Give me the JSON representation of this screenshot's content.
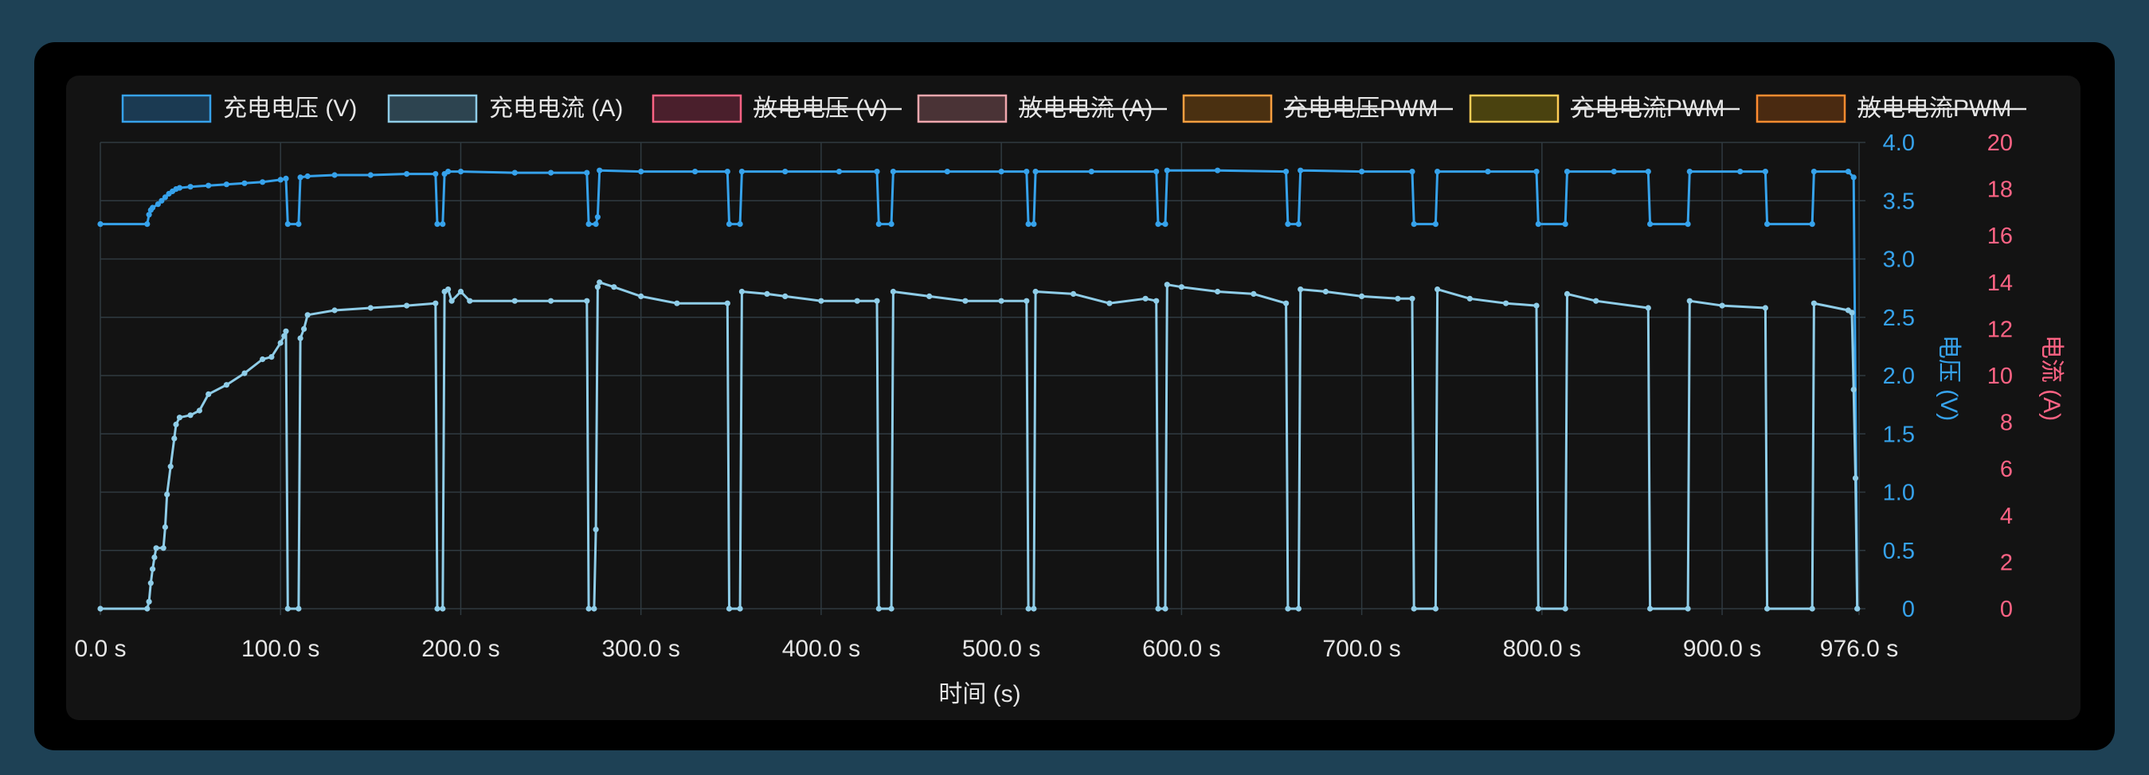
{
  "chart_data": {
    "type": "line",
    "title": "",
    "xlabel": "时间 (s)",
    "ylabel_left": "电压 (V)",
    "ylabel_right": "电流 (A)",
    "xlim": [
      0,
      976
    ],
    "ylim_left": [
      0,
      4
    ],
    "ylim_right": [
      0,
      20
    ],
    "x_ticks": [
      "0.0 s",
      "100.0 s",
      "200.0 s",
      "300.0 s",
      "400.0 s",
      "500.0 s",
      "600.0 s",
      "700.0 s",
      "800.0 s",
      "900.0 s",
      "976.0 s"
    ],
    "y_ticks_left": [
      "0",
      "0.5",
      "1.0",
      "1.5",
      "2.0",
      "2.5",
      "3.0",
      "3.5",
      "4.0"
    ],
    "y_ticks_right": [
      "0",
      "2",
      "4",
      "6",
      "8",
      "10",
      "12",
      "14",
      "16",
      "18",
      "20"
    ],
    "grid": true,
    "legend_position": "top",
    "legend": [
      {
        "label": "充电电压 (V)",
        "visible": true,
        "fill": "#1b3a52",
        "stroke": "#36a2eb"
      },
      {
        "label": "充电电流 (A)",
        "visible": true,
        "fill": "#2d4450",
        "stroke": "#8fcde8"
      },
      {
        "label": "放电电压 (V)",
        "visible": false,
        "fill": "#4a1f2c",
        "stroke": "#ff6384"
      },
      {
        "label": "放电电流 (A)",
        "visible": false,
        "fill": "#4a3336",
        "stroke": "#f2a7ae"
      },
      {
        "label": "充电电压PWM",
        "visible": false,
        "fill": "#4a3011",
        "stroke": "#ff9f40"
      },
      {
        "label": "充电电流PWM",
        "visible": false,
        "fill": "#4a420f",
        "stroke": "#ffcd56"
      },
      {
        "label": "放电电流PWM",
        "visible": false,
        "fill": "#4a2a11",
        "stroke": "#ff8c30"
      }
    ],
    "series": [
      {
        "name": "充电电压 (V)",
        "axis": "left",
        "color": "#36a2eb",
        "points": [
          [
            0,
            3.3
          ],
          [
            26,
            3.3
          ],
          [
            27,
            3.38
          ],
          [
            28,
            3.42
          ],
          [
            29,
            3.44
          ],
          [
            32,
            3.47
          ],
          [
            34,
            3.5
          ],
          [
            36,
            3.53
          ],
          [
            38,
            3.56
          ],
          [
            40,
            3.58
          ],
          [
            42,
            3.6
          ],
          [
            44,
            3.61
          ],
          [
            50,
            3.62
          ],
          [
            60,
            3.63
          ],
          [
            70,
            3.64
          ],
          [
            80,
            3.65
          ],
          [
            90,
            3.66
          ],
          [
            100,
            3.68
          ],
          [
            103,
            3.69
          ],
          [
            104,
            3.3
          ],
          [
            110,
            3.3
          ],
          [
            111,
            3.7
          ],
          [
            115,
            3.71
          ],
          [
            130,
            3.72
          ],
          [
            150,
            3.72
          ],
          [
            170,
            3.73
          ],
          [
            186,
            3.73
          ],
          [
            187,
            3.3
          ],
          [
            190,
            3.3
          ],
          [
            191,
            3.73
          ],
          [
            193,
            3.75
          ],
          [
            200,
            3.75
          ],
          [
            230,
            3.74
          ],
          [
            250,
            3.74
          ],
          [
            270,
            3.74
          ],
          [
            271,
            3.3
          ],
          [
            275,
            3.3
          ],
          [
            276,
            3.36
          ],
          [
            277,
            3.76
          ],
          [
            300,
            3.75
          ],
          [
            330,
            3.75
          ],
          [
            348,
            3.75
          ],
          [
            349,
            3.3
          ],
          [
            355,
            3.3
          ],
          [
            356,
            3.75
          ],
          [
            380,
            3.75
          ],
          [
            410,
            3.75
          ],
          [
            431,
            3.75
          ],
          [
            432,
            3.3
          ],
          [
            439,
            3.3
          ],
          [
            440,
            3.75
          ],
          [
            470,
            3.75
          ],
          [
            500,
            3.75
          ],
          [
            514,
            3.75
          ],
          [
            515,
            3.3
          ],
          [
            518,
            3.3
          ],
          [
            519,
            3.75
          ],
          [
            550,
            3.75
          ],
          [
            586,
            3.75
          ],
          [
            587,
            3.3
          ],
          [
            591,
            3.3
          ],
          [
            592,
            3.76
          ],
          [
            620,
            3.76
          ],
          [
            658,
            3.75
          ],
          [
            659,
            3.3
          ],
          [
            665,
            3.3
          ],
          [
            666,
            3.76
          ],
          [
            700,
            3.75
          ],
          [
            728,
            3.75
          ],
          [
            729,
            3.3
          ],
          [
            741,
            3.3
          ],
          [
            742,
            3.75
          ],
          [
            770,
            3.75
          ],
          [
            797,
            3.75
          ],
          [
            798,
            3.3
          ],
          [
            813,
            3.3
          ],
          [
            814,
            3.75
          ],
          [
            840,
            3.75
          ],
          [
            859,
            3.75
          ],
          [
            860,
            3.3
          ],
          [
            881,
            3.3
          ],
          [
            882,
            3.75
          ],
          [
            910,
            3.75
          ],
          [
            924,
            3.75
          ],
          [
            925,
            3.3
          ],
          [
            950,
            3.3
          ],
          [
            951,
            3.75
          ],
          [
            970,
            3.75
          ],
          [
            973,
            3.7
          ],
          [
            975,
            0
          ]
        ]
      },
      {
        "name": "充电电流 (A)",
        "axis": "right",
        "color": "#8fcde8",
        "points": [
          [
            0,
            0
          ],
          [
            26,
            0
          ],
          [
            27,
            0.3
          ],
          [
            28,
            1.1
          ],
          [
            29,
            1.7
          ],
          [
            30,
            2.2
          ],
          [
            31,
            2.6
          ],
          [
            35,
            2.6
          ],
          [
            36,
            3.5
          ],
          [
            37,
            4.9
          ],
          [
            39,
            6.1
          ],
          [
            41,
            7.3
          ],
          [
            42,
            7.9
          ],
          [
            44,
            8.2
          ],
          [
            50,
            8.3
          ],
          [
            55,
            8.5
          ],
          [
            60,
            9.2
          ],
          [
            70,
            9.6
          ],
          [
            80,
            10.1
          ],
          [
            90,
            10.7
          ],
          [
            95,
            10.8
          ],
          [
            100,
            11.4
          ],
          [
            102,
            11.7
          ],
          [
            103,
            11.9
          ],
          [
            104,
            0
          ],
          [
            110,
            0
          ],
          [
            111,
            11.6
          ],
          [
            113,
            12.0
          ],
          [
            115,
            12.6
          ],
          [
            130,
            12.8
          ],
          [
            150,
            12.9
          ],
          [
            170,
            13.0
          ],
          [
            186,
            13.1
          ],
          [
            187,
            0
          ],
          [
            190,
            0
          ],
          [
            191,
            13.6
          ],
          [
            193,
            13.7
          ],
          [
            195,
            13.2
          ],
          [
            200,
            13.6
          ],
          [
            205,
            13.2
          ],
          [
            230,
            13.2
          ],
          [
            250,
            13.2
          ],
          [
            270,
            13.2
          ],
          [
            271,
            0
          ],
          [
            274,
            0
          ],
          [
            275,
            3.4
          ],
          [
            276,
            13.8
          ],
          [
            277,
            14.0
          ],
          [
            285,
            13.8
          ],
          [
            300,
            13.4
          ],
          [
            320,
            13.1
          ],
          [
            348,
            13.1
          ],
          [
            349,
            0
          ],
          [
            355,
            0
          ],
          [
            356,
            13.6
          ],
          [
            370,
            13.5
          ],
          [
            380,
            13.4
          ],
          [
            400,
            13.2
          ],
          [
            420,
            13.2
          ],
          [
            431,
            13.2
          ],
          [
            432,
            0
          ],
          [
            439,
            0
          ],
          [
            440,
            13.6
          ],
          [
            460,
            13.4
          ],
          [
            480,
            13.2
          ],
          [
            500,
            13.2
          ],
          [
            514,
            13.2
          ],
          [
            515,
            0
          ],
          [
            518,
            0
          ],
          [
            519,
            13.6
          ],
          [
            540,
            13.5
          ],
          [
            560,
            13.1
          ],
          [
            580,
            13.3
          ],
          [
            586,
            13.2
          ],
          [
            587,
            0
          ],
          [
            591,
            0
          ],
          [
            592,
            13.9
          ],
          [
            600,
            13.8
          ],
          [
            620,
            13.6
          ],
          [
            640,
            13.5
          ],
          [
            658,
            13.1
          ],
          [
            659,
            0
          ],
          [
            665,
            0
          ],
          [
            666,
            13.7
          ],
          [
            680,
            13.6
          ],
          [
            700,
            13.4
          ],
          [
            720,
            13.3
          ],
          [
            728,
            13.3
          ],
          [
            729,
            0
          ],
          [
            741,
            0
          ],
          [
            742,
            13.7
          ],
          [
            760,
            13.3
          ],
          [
            780,
            13.1
          ],
          [
            797,
            13.0
          ],
          [
            798,
            0
          ],
          [
            813,
            0
          ],
          [
            814,
            13.5
          ],
          [
            830,
            13.2
          ],
          [
            859,
            12.9
          ],
          [
            860,
            0
          ],
          [
            881,
            0
          ],
          [
            882,
            13.2
          ],
          [
            900,
            13.0
          ],
          [
            924,
            12.9
          ],
          [
            925,
            0
          ],
          [
            950,
            0
          ],
          [
            951,
            13.1
          ],
          [
            970,
            12.8
          ],
          [
            972,
            12.7
          ],
          [
            973,
            9.4
          ],
          [
            974,
            5.6
          ],
          [
            975,
            0
          ]
        ]
      }
    ]
  }
}
